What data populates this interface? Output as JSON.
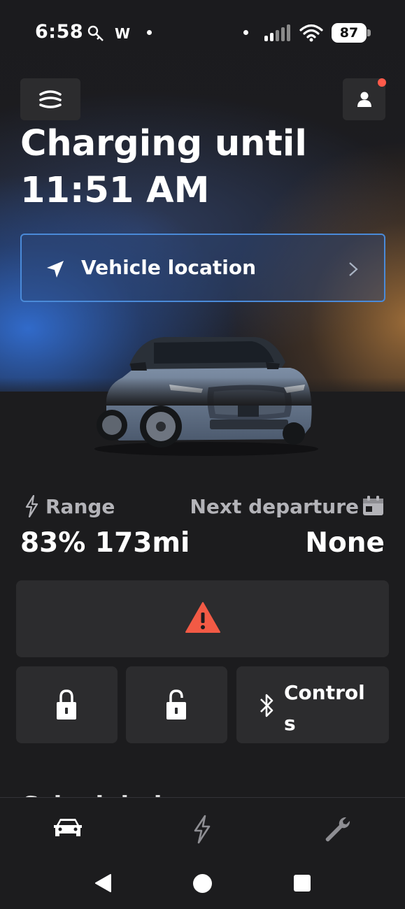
{
  "status_bar": {
    "time": "6:58",
    "app_letter": "W",
    "battery": "87"
  },
  "header": {
    "menu_icon": "car-menu-icon",
    "profile_icon": "person-icon",
    "title_line1": "Charging until",
    "title_line2": "11:51 AM"
  },
  "location": {
    "label": "Vehicle location"
  },
  "stats": {
    "range_label": "Range",
    "range_value": "83% 173mi",
    "departure_label": "Next departure",
    "departure_value": "None"
  },
  "controls": {
    "controls_label": "Controls"
  },
  "section_peek": "Scheduled",
  "tabs": [
    "vehicle-icon",
    "charge-icon",
    "wrench-icon"
  ],
  "colors": {
    "background": "#1c1c1e",
    "tile": "#2c2c2e",
    "accent_blue": "#4a8ad8",
    "alert_red": "#f25a45",
    "notification": "#ff5a4a"
  }
}
